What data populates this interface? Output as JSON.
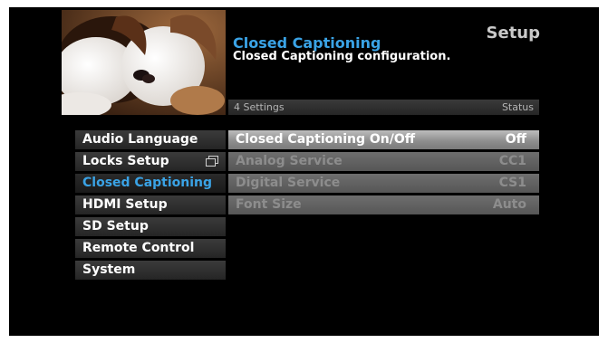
{
  "header": {
    "title": "Closed Captioning",
    "subtitle": "Closed Captioning configuration.",
    "section": "Setup"
  },
  "status_bar": {
    "count_label": "4 Settings",
    "status_label": "Status"
  },
  "menu": {
    "items": [
      {
        "label": "Audio Language"
      },
      {
        "label": "Locks Setup",
        "icon": "lock-icon"
      },
      {
        "label": "Closed Captioning",
        "selected": true
      },
      {
        "label": "HDMI Setup"
      },
      {
        "label": "SD Setup"
      },
      {
        "label": "Remote Control"
      },
      {
        "label": "System"
      }
    ]
  },
  "settings": {
    "items": [
      {
        "label": "Closed Captioning On/Off",
        "value": "Off",
        "enabled": true
      },
      {
        "label": "Analog Service",
        "value": "CC1",
        "enabled": false
      },
      {
        "label": "Digital Service",
        "value": "CS1",
        "enabled": false
      },
      {
        "label": "Font Size",
        "value": "Auto",
        "enabled": false
      }
    ]
  },
  "colors": {
    "accent": "#3aa3e6",
    "background": "#000000",
    "selected_row": "#8f8f8f",
    "disabled_text": "#8d8d8d"
  }
}
